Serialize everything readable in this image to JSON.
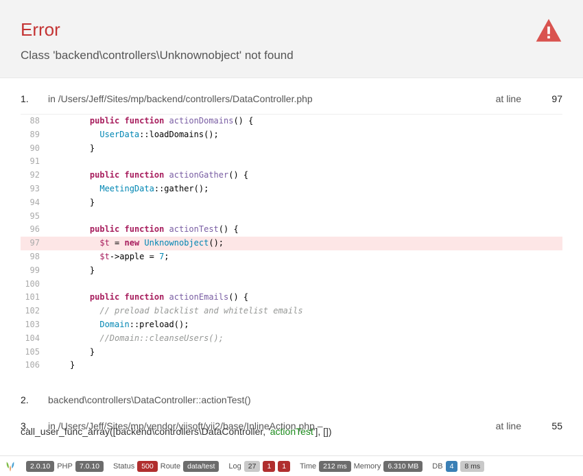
{
  "header": {
    "title": "Error",
    "message": "Class 'backend\\controllers\\Unknownobject' not found"
  },
  "frames": [
    {
      "num": "1.",
      "prefix": "in ",
      "file": "/Users/Jeff/Sites/mp/backend/controllers/DataController.php",
      "atline": "at line",
      "lineno": "97"
    },
    {
      "num": "2.",
      "file": "backend\\controllers\\DataController::actionTest()"
    },
    {
      "num": "3.",
      "prefix": "in ",
      "file": "/Users/Jeff/Sites/mp/vendor/yiisoft/yii2/base/InlineAction.php",
      "suffix": " –",
      "atline": "at line",
      "lineno": "55",
      "extra_a": "call_user_func_array([backend\\controllers\\DataController, '",
      "extra_b": "actionTest",
      "extra_c": "'], [])"
    }
  ],
  "code": {
    "lines": [
      {
        "n": "88"
      },
      {
        "n": "89"
      },
      {
        "n": "90"
      },
      {
        "n": "91"
      },
      {
        "n": "92"
      },
      {
        "n": "93"
      },
      {
        "n": "94"
      },
      {
        "n": "95"
      },
      {
        "n": "96"
      },
      {
        "n": "97"
      },
      {
        "n": "98"
      },
      {
        "n": "99"
      },
      {
        "n": "100"
      },
      {
        "n": "101"
      },
      {
        "n": "102"
      },
      {
        "n": "103"
      },
      {
        "n": "104"
      },
      {
        "n": "105"
      },
      {
        "n": "106"
      }
    ]
  },
  "toolbar": {
    "yii_version": "2.0.10",
    "php_label": "PHP",
    "php_version": "7.0.10",
    "status_label": "Status",
    "status_code": "500",
    "route_label": "Route",
    "route_value": "data/test",
    "log_label": "Log",
    "log_a": "27",
    "log_b": "1",
    "log_c": "1",
    "time_label": "Time",
    "time_value": "212 ms",
    "memory_label": "Memory",
    "memory_value": "6.310 MB",
    "db_label": "DB",
    "db_a": "4",
    "db_b": "8 ms"
  }
}
